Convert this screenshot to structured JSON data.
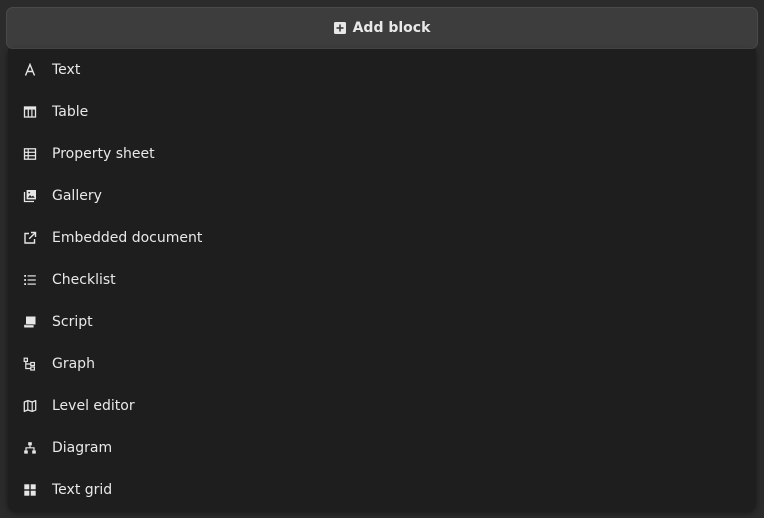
{
  "add_block": {
    "label": "Add block",
    "icon": "plus-square-icon"
  },
  "menu": {
    "items": [
      {
        "label": "Text",
        "icon": "text-a-icon"
      },
      {
        "label": "Table",
        "icon": "table-icon"
      },
      {
        "label": "Property sheet",
        "icon": "property-sheet-icon"
      },
      {
        "label": "Gallery",
        "icon": "gallery-icon"
      },
      {
        "label": "Embedded document",
        "icon": "external-link-icon"
      },
      {
        "label": "Checklist",
        "icon": "checklist-icon"
      },
      {
        "label": "Script",
        "icon": "scroll-icon"
      },
      {
        "label": "Graph",
        "icon": "graph-tree-icon"
      },
      {
        "label": "Level editor",
        "icon": "map-icon"
      },
      {
        "label": "Diagram",
        "icon": "diagram-icon"
      },
      {
        "label": "Text grid",
        "icon": "grid-icon"
      }
    ]
  },
  "colors": {
    "background": "#2b2b2b",
    "button": "#3d3d3d",
    "menu": "#1e1e1e",
    "text": "#e9e9e9"
  }
}
